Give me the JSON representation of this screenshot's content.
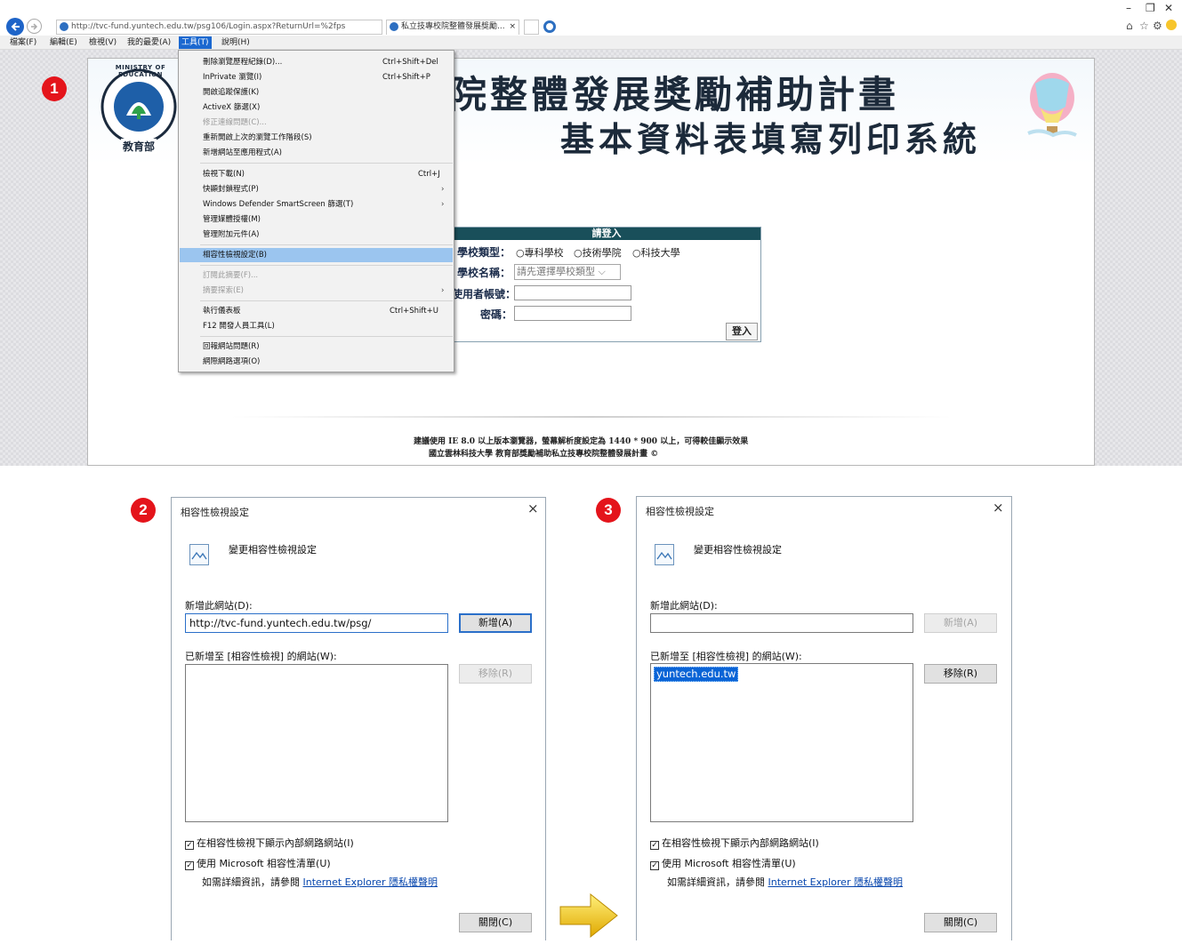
{
  "browser": {
    "url": "http://tvc-fund.yuntech.edu.tw/psg106/Login.aspx?ReturnUrl=%2fps",
    "tab_title": "私立技專校院整體發展獎勵...",
    "tab_close": "×",
    "window_controls": [
      "–",
      "❐",
      "✕"
    ],
    "menu": [
      {
        "label": "檔案(F)"
      },
      {
        "label": "編輯(E)"
      },
      {
        "label": "檢視(V)"
      },
      {
        "label": "我的最愛(A)"
      },
      {
        "label": "工具(T)"
      },
      {
        "label": "說明(H)"
      }
    ]
  },
  "tools_menu": {
    "items": [
      {
        "label": "刪除瀏覽歷程紀錄(D)...",
        "shortcut": "Ctrl+Shift+Del"
      },
      {
        "label": "InPrivate 瀏覽(I)",
        "shortcut": "Ctrl+Shift+P"
      },
      {
        "label": "開啟追蹤保護(K)",
        "shortcut": ""
      },
      {
        "label": "ActiveX 篩選(X)",
        "shortcut": ""
      },
      {
        "label": "修正連線問題(C)...",
        "shortcut": ""
      },
      {
        "label": "重新開啟上次的瀏覽工作階段(S)",
        "shortcut": ""
      },
      {
        "label": "新增網站至應用程式(A)",
        "shortcut": ""
      },
      {
        "label": "檢視下載(N)",
        "shortcut": "Ctrl+J"
      },
      {
        "label": "快顯封鎖程式(P)",
        "shortcut": ""
      },
      {
        "label": "Windows Defender SmartScreen 篩選(T)",
        "shortcut": ""
      },
      {
        "label": "管理媒體授權(M)",
        "shortcut": ""
      },
      {
        "label": "管理附加元件(A)",
        "shortcut": ""
      },
      {
        "label": "相容性檢視設定(B)",
        "shortcut": ""
      },
      {
        "label": "訂閱此摘要(F)...",
        "shortcut": ""
      },
      {
        "label": "摘要探索(E)",
        "shortcut": ""
      },
      {
        "label": "執行儀表板",
        "shortcut": "Ctrl+Shift+U"
      },
      {
        "label": "F12 開發人員工具(L)",
        "shortcut": ""
      },
      {
        "label": "回報網站問題(R)",
        "shortcut": ""
      },
      {
        "label": "網際網路選項(O)",
        "shortcut": ""
      }
    ]
  },
  "page": {
    "title_line1": "院整體發展獎勵補助計畫",
    "title_line2": "基本資料表填寫列印系統",
    "logo_text": "MINISTRY OF EDUCATION",
    "logo_sub": "教育部",
    "login": {
      "header": "請登入",
      "school_type_label": "學校類型：",
      "school_type_options": [
        "○專科學校",
        "○技術學院",
        "○科技大學"
      ],
      "school_name_label": "學校名稱：",
      "school_name_select": "請先選擇學校類型 ⌵",
      "username_label": "使用者帳號：",
      "password_label": "密碼：",
      "login_button": "登入"
    },
    "footer_line1": "建議使用 IE 8.0 以上版本瀏覽器，螢幕解析度設定為 1440 * 900 以上，可得較佳顯示效果",
    "footer_line2": "國立雲林科技大學 教育部獎勵補助私立技專校院整體發展計畫 ©"
  },
  "badges": [
    "1",
    "2",
    "3"
  ],
  "dialog_before": {
    "title": "相容性檢視設定",
    "close": "×",
    "heading": "變更相容性檢視設定",
    "add_label": "新增此網站(D):",
    "add_value": "http://tvc-fund.yuntech.edu.tw/psg/",
    "add_button": "新增(A)",
    "list_label": "已新增至 [相容性檢視] 的網站(W):",
    "list_items": [],
    "remove_button": "移除(R)",
    "check1": "在相容性檢視下顯示內部網路網站(I)",
    "check2": "使用 Microsoft 相容性清單(U)",
    "info_prefix": "如需詳細資訊，請參閱",
    "info_link": "Internet Explorer 隱私權聲明",
    "close_button": "關閉(C)"
  },
  "dialog_after": {
    "title": "相容性檢視設定",
    "close": "×",
    "heading": "變更相容性檢視設定",
    "add_label": "新增此網站(D):",
    "add_value": "",
    "add_button": "新增(A)",
    "list_label": "已新增至 [相容性檢視] 的網站(W):",
    "list_items": [
      "yuntech.edu.tw"
    ],
    "remove_button": "移除(R)",
    "check1": "在相容性檢視下顯示內部網路網站(I)",
    "check2": "使用 Microsoft 相容性清單(U)",
    "info_prefix": "如需詳細資訊，請參閱",
    "info_link": "Internet Explorer 隱私權聲明",
    "close_button": "關閉(C)"
  },
  "colors": {
    "badge": "#e4141b",
    "menu_highlight": "#9bc5ef",
    "login_header": "#194f5a",
    "arrow": "#f2c400"
  }
}
